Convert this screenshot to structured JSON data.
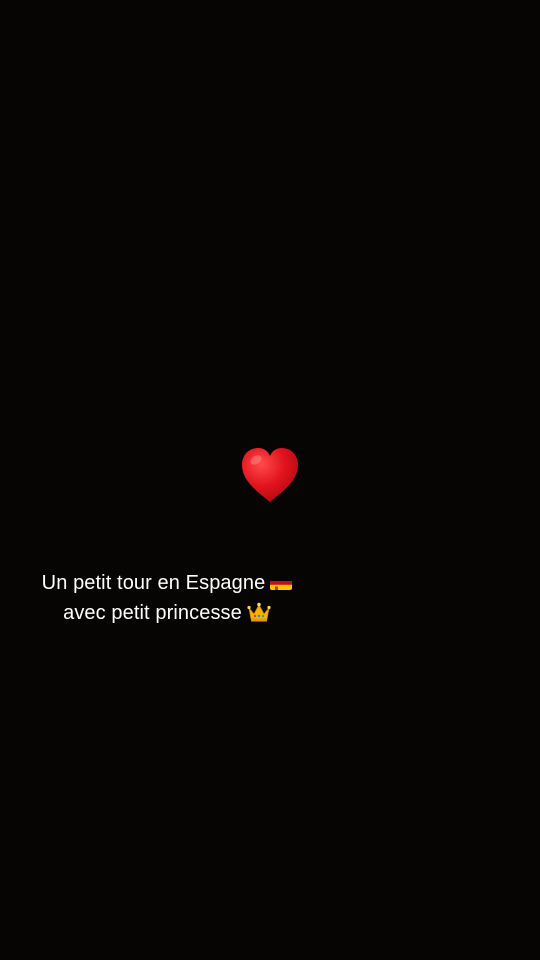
{
  "caption": {
    "line1": "Un petit tour en Espagne",
    "line2": "avec petit princesse",
    "line1_emoji": "spain-flag-icon",
    "line2_emoji": "crown-icon"
  },
  "sticker": {
    "icon": "red-heart-icon",
    "color": "#e4101c"
  },
  "background": "#070404"
}
